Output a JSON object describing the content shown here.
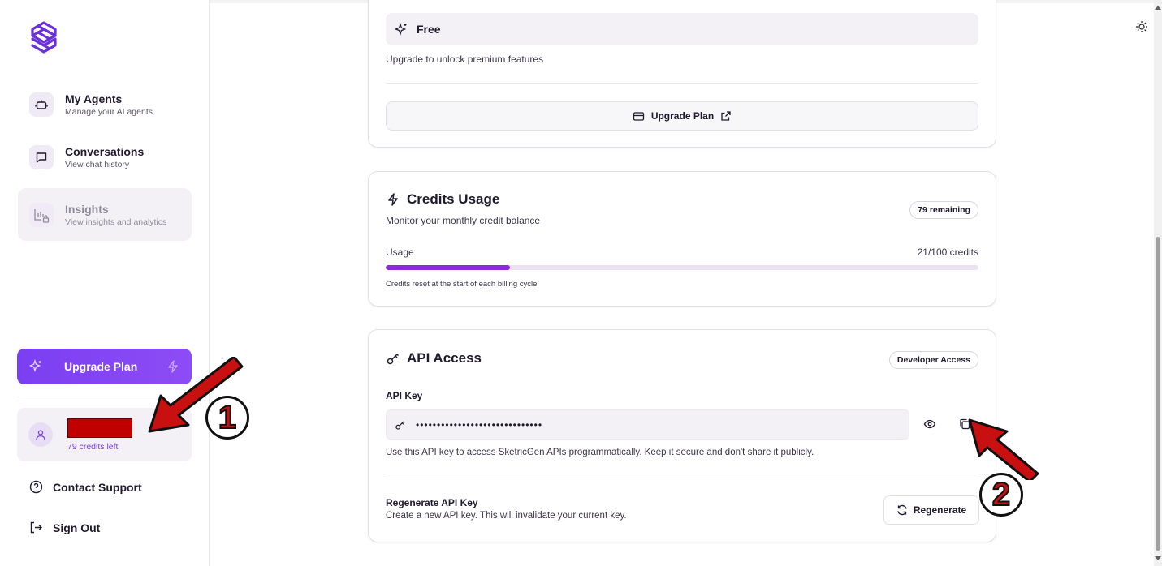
{
  "sidebar": {
    "nav": [
      {
        "label": "My Agents",
        "sub": "Manage your AI agents"
      },
      {
        "label": "Conversations",
        "sub": "View chat history"
      },
      {
        "label": "Insights",
        "sub": "View insights and analytics"
      }
    ],
    "upgrade_label": "Upgrade Plan",
    "user": {
      "credits": "79 credits left"
    },
    "contact_label": "Contact Support",
    "signout_label": "Sign Out"
  },
  "plan": {
    "name": "Free",
    "subtitle": "Upgrade to unlock premium features",
    "upgrade_label": "Upgrade Plan"
  },
  "credits": {
    "title": "Credits Usage",
    "subtitle": "Monitor your monthly credit balance",
    "badge": "79 remaining",
    "usage_label": "Usage",
    "usage_value": "21/100 credits",
    "used": 21,
    "total": 100,
    "note": "Credits reset at the start of each billing cycle"
  },
  "api": {
    "title": "API Access",
    "badge": "Developer Access",
    "key_label": "API Key",
    "key_masked": "••••••••••••••••••••••••••••••",
    "note": "Use this API key to access SketricGen APIs programmatically. Keep it secure and don't share it publicly.",
    "regen_title": "Regenerate API Key",
    "regen_sub": "Create a new API key. This will invalidate your current key.",
    "regen_button": "Regenerate"
  },
  "annotations": {
    "one": "1",
    "two": "2"
  },
  "colors": {
    "accent": "#7b3ff2",
    "progress": "#8a2be2",
    "annotation_red": "#c81010"
  }
}
